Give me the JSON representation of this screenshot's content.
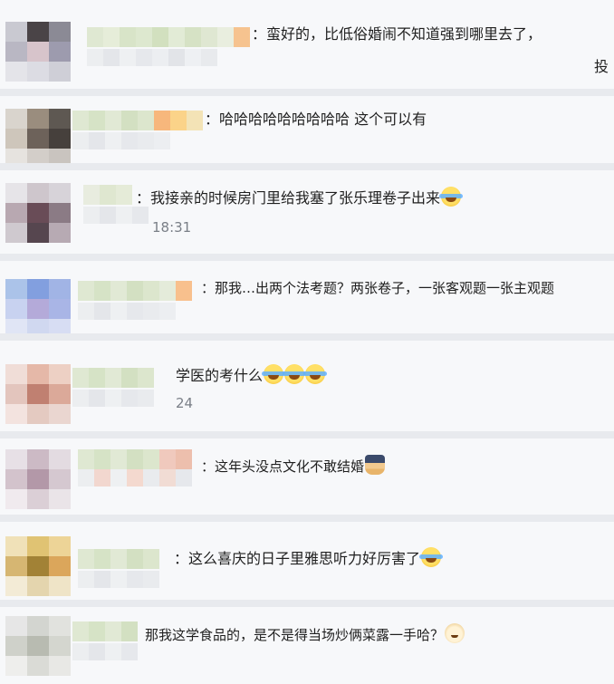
{
  "comments": [
    {
      "text": "：蛮好的，比低俗婚闹不知道强到哪里去了，",
      "cont": "投"
    },
    {
      "text": "：哈哈哈哈哈哈哈哈哈 这个可以有"
    },
    {
      "text": "：我接亲的时候房门里给我塞了张乐理卷子出来",
      "time": "18:31",
      "emoji": [
        "grinning-squinting-tears-icon"
      ]
    },
    {
      "text": "：那我…出两个法考题？两张卷子，一张客观题一张主观题"
    },
    {
      "text": "学医的考什么",
      "time": "24",
      "emoji": [
        "tears-of-joy-icon",
        "tears-of-joy-icon",
        "tears-of-joy-icon"
      ]
    },
    {
      "text": "：这年头没点文化不敢结婚",
      "emoji": [
        "person-icon"
      ]
    },
    {
      "text": "：这么喜庆的日子里雅思听力好厉害了",
      "emoji": [
        "tears-of-joy-icon"
      ]
    },
    {
      "text": "那我这学食品的，是不是得当场炒俩菜露一手哈？",
      "emoji": [
        "doge-icon"
      ]
    }
  ]
}
